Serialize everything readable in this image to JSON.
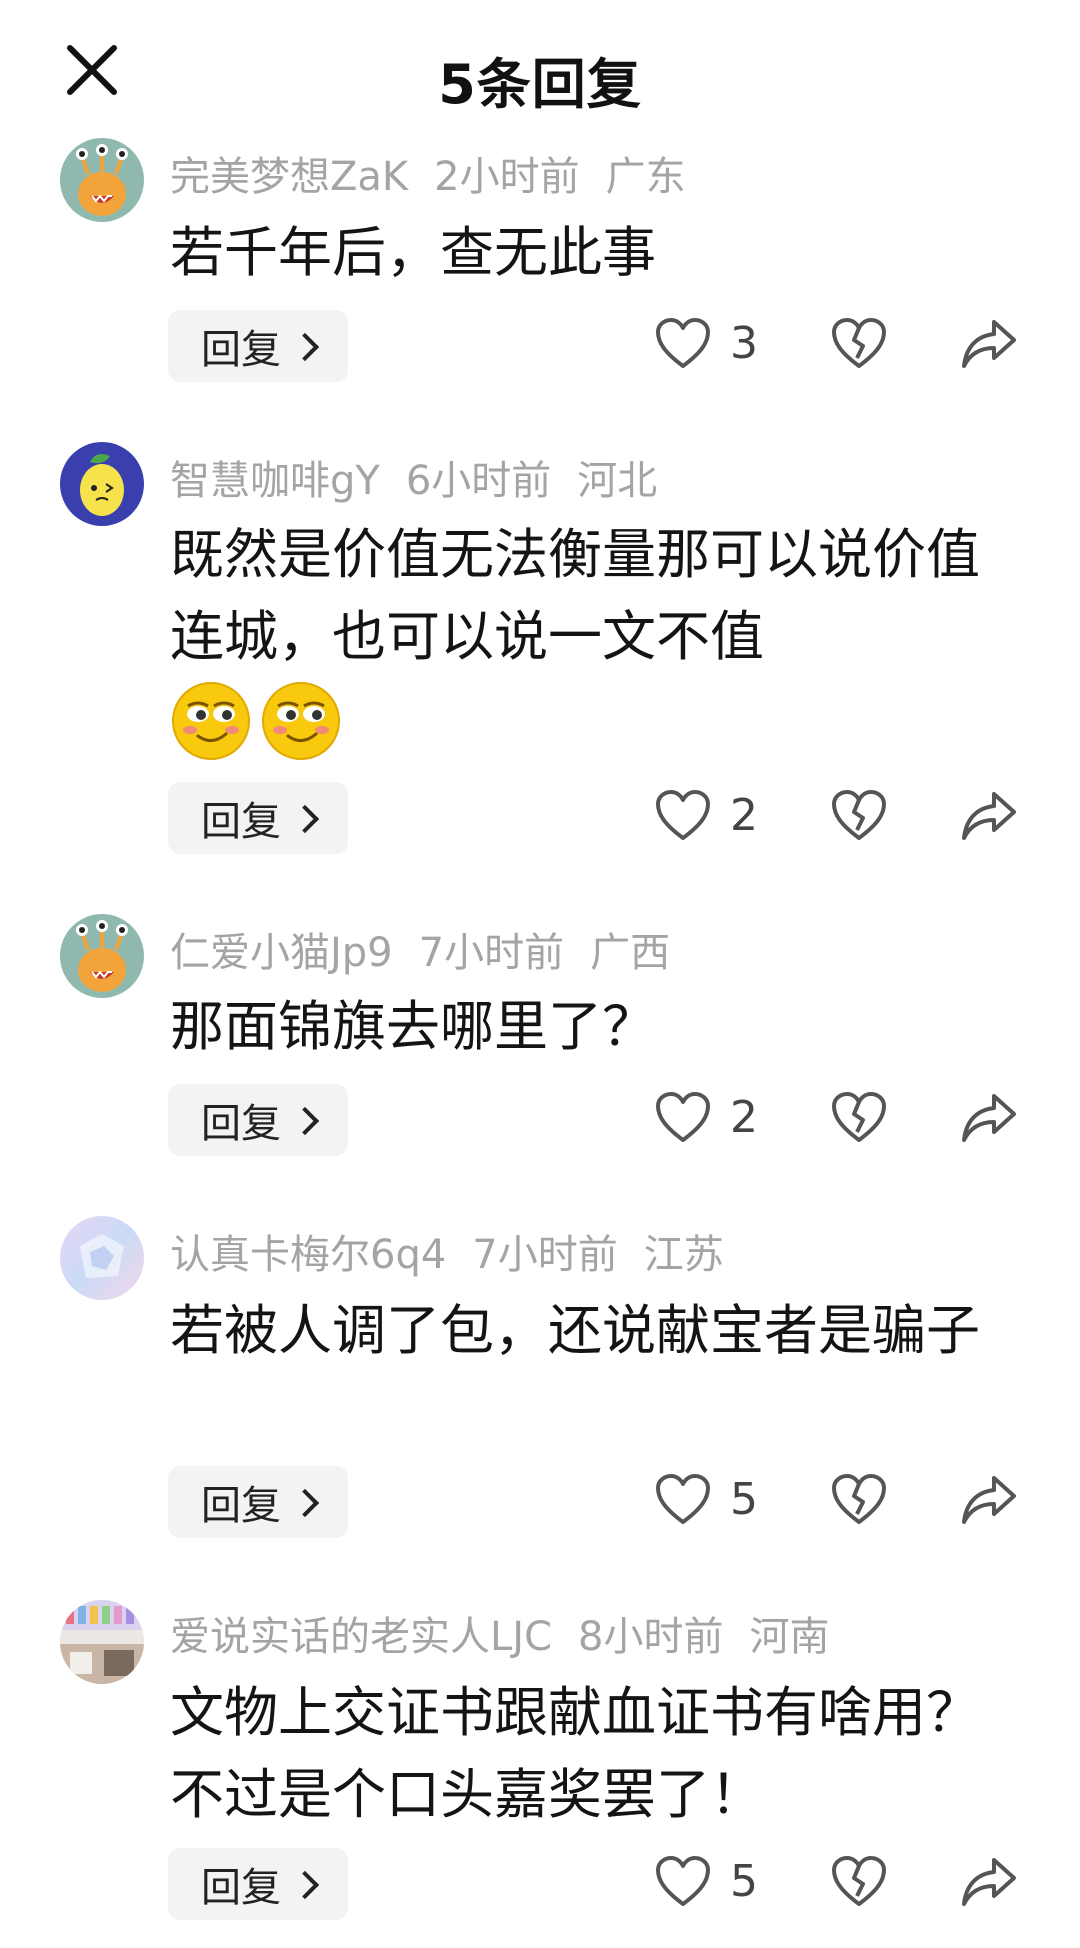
{
  "header": {
    "title": "5条回复",
    "close_icon": "close-icon"
  },
  "comments": [
    {
      "user": "完美梦想ZaK",
      "time": "2小时前",
      "location": "广东",
      "text": "若千年后，查无此事",
      "likes": "3",
      "reply_label": "回复",
      "avatar": "monster-avatar"
    },
    {
      "user": "智慧咖啡gY",
      "time": "6小时前",
      "location": "河北",
      "text": "既然是价值无法衡量那可以说价值连城，也可以说一文不值",
      "likes": "2",
      "reply_label": "回复",
      "avatar": "lemon-avatar",
      "emojis": [
        "smirk-emoji",
        "smirk-emoji"
      ]
    },
    {
      "user": "仁爱小猫Jp9",
      "time": "7小时前",
      "location": "广西",
      "text": "那面锦旗去哪里了？",
      "likes": "2",
      "reply_label": "回复",
      "avatar": "monster-avatar"
    },
    {
      "user": "认真卡梅尔6q4",
      "time": "7小时前",
      "location": "江苏",
      "text": "若被人调了包，还说献宝者是骗子",
      "likes": "5",
      "reply_label": "回复",
      "avatar": "holographic-avatar"
    },
    {
      "user": "爱说实话的老实人LJC",
      "time": "8小时前",
      "location": "河南",
      "text": "文物上交证书跟献血证书有啥用？不过是个口头嘉奖罢了！",
      "likes": "5",
      "reply_label": "回复",
      "avatar": "photo-avatar"
    }
  ],
  "colors": {
    "meta_gray": "#a4a4a4",
    "text": "#141414",
    "reply_bg": "#f3f3f3",
    "icon_gray": "#555555"
  }
}
